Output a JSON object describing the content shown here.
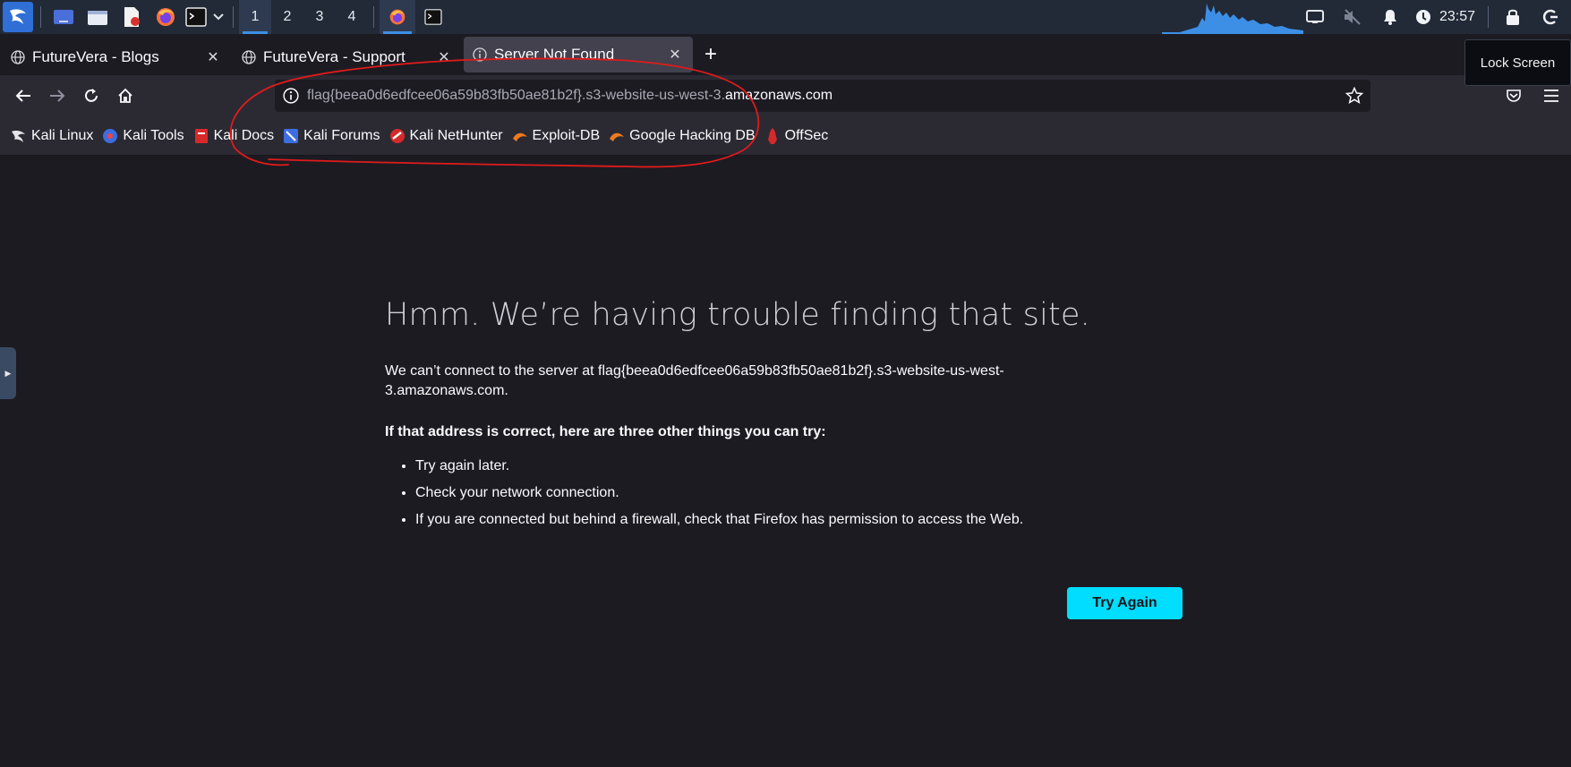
{
  "panel": {
    "workspaces": [
      "1",
      "2",
      "3",
      "4"
    ],
    "active_workspace": "1",
    "clock": "23:57",
    "icons": [
      "kali-menu-icon",
      "show-desktop-icon",
      "file-manager-icon",
      "text-editor-icon",
      "firefox-icon",
      "terminal-icon",
      "network-icon",
      "mute-icon",
      "notification-icon",
      "power-manager-icon",
      "lock-icon",
      "logout-icon"
    ]
  },
  "lock_tooltip": "Lock Screen",
  "tabs": [
    {
      "title": "FutureVera - Blogs",
      "active": false
    },
    {
      "title": "FutureVera - Support",
      "active": false
    },
    {
      "title": "Server Not Found",
      "active": true
    }
  ],
  "urlbar": {
    "url_dim": "flag{beea0d6edfcee06a59b83fb50ae81b2f}.s3-website-us-west-3.",
    "url_bright": "amazonaws.com"
  },
  "bookmarks": [
    {
      "label": "Kali Linux",
      "icon": "kali-linux-icon"
    },
    {
      "label": "Kali Tools",
      "icon": "kali-tools-icon"
    },
    {
      "label": "Kali Docs",
      "icon": "kali-docs-icon"
    },
    {
      "label": "Kali Forums",
      "icon": "kali-forums-icon"
    },
    {
      "label": "Kali NetHunter",
      "icon": "kali-nethunter-icon"
    },
    {
      "label": "Exploit-DB",
      "icon": "exploit-db-icon"
    },
    {
      "label": "Google Hacking DB",
      "icon": "google-hacking-db-icon"
    },
    {
      "label": "OffSec",
      "icon": "offsec-icon"
    }
  ],
  "error": {
    "title": "Hmm. We’re having trouble finding that site.",
    "description": "We can’t connect to the server at flag{beea0d6edfcee06a59b83fb50ae81b2f}.s3-website-us-west-3.amazonaws.com.",
    "subtitle": "If that address is correct, here are three other things you can try:",
    "suggestions": [
      "Try again later.",
      "Check your network connection.",
      "If you are connected but behind a firewall, check that Firefox has permission to access the Web."
    ],
    "button": "Try Again"
  },
  "colors": {
    "accent": "#00ddff",
    "annotation": "#e01b1b",
    "panel_active": "#3d8fe6"
  }
}
